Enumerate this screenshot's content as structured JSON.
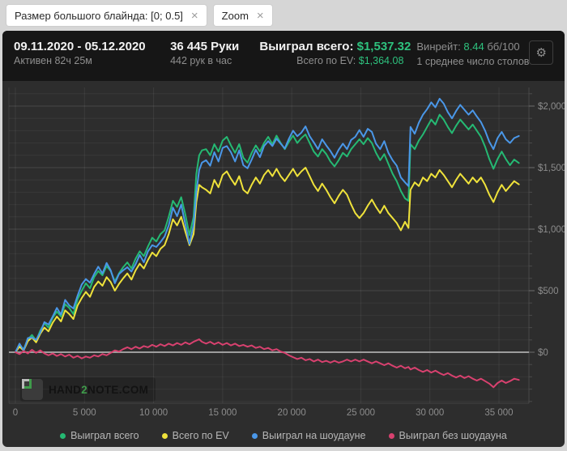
{
  "filter_bar": {
    "chips": [
      {
        "label": "Размер большого блайнда: [0; 0.5]"
      },
      {
        "label": "Zoom"
      }
    ]
  },
  "icons": {
    "gear": "⚙",
    "close": "×"
  },
  "header": {
    "date_range": "09.11.2020 - 05.12.2020",
    "active_time": "Активен 82ч 25м",
    "hands_total": "36 445 Руки",
    "hands_per_hour": "442 рук в час",
    "won_total_label": "Выиграл всего:",
    "won_total_value": "$1,537.32",
    "ev_total_label": "Всего по EV:",
    "ev_total_value": "$1,364.08",
    "winrate_label": "Винрейт:",
    "winrate_value": "8.44",
    "winrate_unit": "бб/100",
    "avg_tables": "1 среднее число столов"
  },
  "watermark": {
    "pre": "HAND",
    "mid": "2",
    "post": "NOTE.COM"
  },
  "colors": {
    "panel_bg": "#2d2d2d",
    "header_bg": "#161616",
    "zero_line": "#9c9c9c",
    "axis_text": "#8c8c8c",
    "accent_value": "#2ec27e"
  },
  "chart_data": {
    "type": "line",
    "title": "",
    "xlabel": "hands",
    "ylabel": "$ won",
    "x_max": 36445,
    "grid": true,
    "legend_position": "bottom",
    "x_ticks": [
      {
        "v": 0,
        "label": "0"
      },
      {
        "v": 5000,
        "label": "5 000"
      },
      {
        "v": 10000,
        "label": "10 000"
      },
      {
        "v": 15000,
        "label": "15 000"
      },
      {
        "v": 20000,
        "label": "20 000"
      },
      {
        "v": 25000,
        "label": "25 000"
      },
      {
        "v": 30000,
        "label": "30 000"
      },
      {
        "v": 35000,
        "label": "35 000"
      }
    ],
    "y_ticks": [
      {
        "v": 0,
        "label": "$0"
      },
      {
        "v": 500,
        "label": "$500"
      },
      {
        "v": 1000,
        "label": "$1,000"
      },
      {
        "v": 1500,
        "label": "$1,500"
      },
      {
        "v": 2000,
        "label": "$2,000"
      }
    ],
    "y_minor_step": 100,
    "y_range": [
      -400,
      2100
    ],
    "x": [
      0,
      300,
      600,
      900,
      1200,
      1500,
      1800,
      2100,
      2400,
      2700,
      3000,
      3300,
      3600,
      3900,
      4200,
      4500,
      4800,
      5100,
      5400,
      5700,
      6000,
      6300,
      6600,
      6900,
      7200,
      7500,
      7800,
      8100,
      8400,
      8700,
      9000,
      9300,
      9600,
      9900,
      10200,
      10500,
      10800,
      11100,
      11400,
      11700,
      12000,
      12300,
      12600,
      12900,
      13100,
      13300,
      13500,
      13800,
      14100,
      14400,
      14700,
      15000,
      15300,
      15600,
      15900,
      16200,
      16500,
      16800,
      17100,
      17400,
      17700,
      18000,
      18300,
      18600,
      18900,
      19200,
      19500,
      19800,
      20100,
      20400,
      20700,
      21000,
      21300,
      21600,
      21900,
      22200,
      22500,
      22800,
      23100,
      23400,
      23700,
      24000,
      24300,
      24600,
      24900,
      25200,
      25500,
      25800,
      26100,
      26400,
      26700,
      27000,
      27300,
      27600,
      27900,
      28200,
      28450,
      28600,
      28900,
      29200,
      29500,
      29800,
      30100,
      30400,
      30700,
      31000,
      31300,
      31600,
      31900,
      32200,
      32500,
      32800,
      33100,
      33400,
      33700,
      34000,
      34300,
      34600,
      34900,
      35200,
      35500,
      35800,
      36100,
      36445
    ],
    "series": [
      {
        "name": "Выиграл всего",
        "color": "#25b973",
        "values": [
          0,
          55,
          25,
          105,
          140,
          95,
          175,
          235,
          200,
          280,
          330,
          290,
          390,
          360,
          310,
          430,
          500,
          560,
          520,
          610,
          660,
          625,
          700,
          660,
          575,
          640,
          690,
          730,
          680,
          760,
          820,
          780,
          860,
          930,
          900,
          960,
          990,
          1100,
          1230,
          1180,
          1260,
          1120,
          950,
          1100,
          1450,
          1600,
          1640,
          1650,
          1600,
          1690,
          1630,
          1720,
          1750,
          1680,
          1620,
          1690,
          1580,
          1540,
          1620,
          1680,
          1630,
          1700,
          1750,
          1690,
          1760,
          1700,
          1650,
          1710,
          1760,
          1700,
          1740,
          1770,
          1700,
          1630,
          1590,
          1650,
          1610,
          1550,
          1510,
          1560,
          1620,
          1590,
          1650,
          1690,
          1730,
          1690,
          1740,
          1700,
          1620,
          1560,
          1610,
          1530,
          1450,
          1390,
          1310,
          1250,
          1230,
          1690,
          1650,
          1720,
          1770,
          1830,
          1890,
          1850,
          1930,
          1890,
          1830,
          1780,
          1840,
          1890,
          1850,
          1810,
          1850,
          1800,
          1750,
          1670,
          1570,
          1490,
          1570,
          1630,
          1570,
          1520,
          1565,
          1537.32
        ]
      },
      {
        "name": "Всего по EV",
        "color": "#efe23b",
        "values": [
          0,
          45,
          15,
          90,
          120,
          80,
          150,
          200,
          170,
          240,
          290,
          250,
          340,
          310,
          270,
          380,
          440,
          490,
          450,
          530,
          575,
          540,
          610,
          570,
          500,
          555,
          600,
          640,
          590,
          665,
          720,
          680,
          750,
          810,
          780,
          840,
          870,
          960,
          1080,
          1030,
          1100,
          980,
          870,
          960,
          1220,
          1360,
          1340,
          1320,
          1290,
          1400,
          1340,
          1440,
          1470,
          1410,
          1360,
          1430,
          1320,
          1290,
          1360,
          1420,
          1370,
          1440,
          1480,
          1430,
          1490,
          1430,
          1390,
          1440,
          1490,
          1430,
          1470,
          1500,
          1430,
          1360,
          1310,
          1370,
          1320,
          1260,
          1210,
          1270,
          1320,
          1280,
          1200,
          1130,
          1090,
          1130,
          1190,
          1240,
          1180,
          1130,
          1190,
          1130,
          1090,
          1050,
          990,
          1060,
          1010,
          1320,
          1380,
          1350,
          1420,
          1390,
          1450,
          1420,
          1480,
          1440,
          1390,
          1340,
          1400,
          1450,
          1410,
          1370,
          1420,
          1380,
          1420,
          1360,
          1280,
          1220,
          1300,
          1360,
          1310,
          1350,
          1390,
          1364.08
        ]
      },
      {
        "name": "Выиграл на шоудауне",
        "color": "#4a97e8",
        "values": [
          0,
          70,
          15,
          115,
          120,
          100,
          160,
          245,
          225,
          290,
          360,
          305,
          425,
          380,
          355,
          460,
          550,
          595,
          565,
          635,
          695,
          640,
          725,
          665,
          560,
          635,
          665,
          690,
          655,
          715,
          790,
          730,
          820,
          870,
          855,
          895,
          940,
          1030,
          1175,
          1105,
          1200,
          1040,
          880,
          1030,
          1300,
          1480,
          1540,
          1560,
          1515,
          1625,
          1550,
          1660,
          1675,
          1625,
          1550,
          1640,
          1520,
          1495,
          1565,
          1645,
          1585,
          1675,
          1715,
          1675,
          1735,
          1695,
          1655,
          1735,
          1800,
          1755,
          1785,
          1835,
          1755,
          1705,
          1650,
          1730,
          1680,
          1635,
          1580,
          1645,
          1695,
          1650,
          1725,
          1750,
          1805,
          1750,
          1815,
          1790,
          1695,
          1650,
          1715,
          1620,
          1560,
          1515,
          1420,
          1380,
          1350,
          1830,
          1775,
          1865,
          1930,
          1975,
          2030,
          1990,
          2060,
          2020,
          1950,
          1900,
          1960,
          2010,
          1970,
          1930,
          1965,
          1915,
          1870,
          1800,
          1710,
          1650,
          1740,
          1790,
          1730,
          1700,
          1740,
          1757
        ]
      },
      {
        "name": "Выиграл без шоудауна",
        "color": "#d8416f",
        "values": [
          0,
          -15,
          10,
          -10,
          20,
          -5,
          15,
          -10,
          -25,
          -10,
          -30,
          -15,
          -35,
          -20,
          -45,
          -30,
          -50,
          -35,
          -45,
          -25,
          -35,
          -15,
          -25,
          -5,
          15,
          5,
          25,
          40,
          25,
          45,
          30,
          50,
          40,
          60,
          45,
          65,
          50,
          70,
          55,
          75,
          60,
          80,
          65,
          85,
          95,
          105,
          85,
          70,
          85,
          65,
          80,
          60,
          75,
          55,
          70,
          50,
          60,
          45,
          55,
          35,
          45,
          25,
          35,
          15,
          25,
          5,
          -5,
          -25,
          -40,
          -55,
          -45,
          -65,
          -55,
          -75,
          -60,
          -80,
          -70,
          -85,
          -70,
          -85,
          -75,
          -60,
          -75,
          -60,
          -75,
          -60,
          -75,
          -90,
          -75,
          -90,
          -105,
          -90,
          -110,
          -125,
          -110,
          -130,
          -120,
          -140,
          -125,
          -145,
          -160,
          -145,
          -165,
          -150,
          -170,
          -185,
          -170,
          -190,
          -205,
          -190,
          -210,
          -195,
          -215,
          -230,
          -215,
          -235,
          -255,
          -285,
          -250,
          -230,
          -250,
          -235,
          -215,
          -225
        ]
      }
    ]
  }
}
